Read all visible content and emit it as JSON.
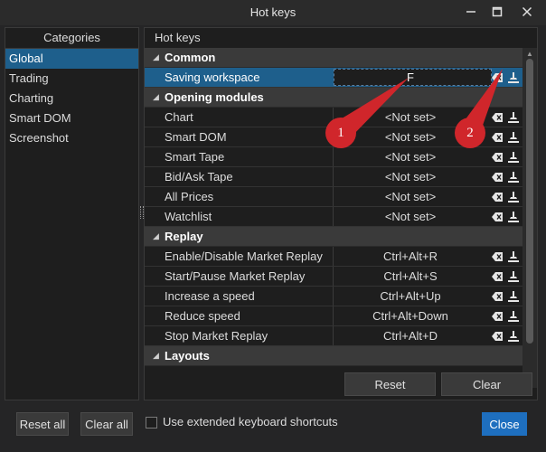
{
  "window": {
    "title": "Hot keys",
    "controls": [
      "minimize-icon",
      "maximize-icon",
      "close-icon"
    ]
  },
  "categories": {
    "header": "Categories",
    "items": [
      "Global",
      "Trading",
      "Charting",
      "Smart DOM",
      "Screenshot"
    ],
    "selected": "Global"
  },
  "hotkeys": {
    "header": "Hot keys",
    "groups": [
      {
        "name": "Common",
        "rows": [
          {
            "name": "Saving workspace",
            "value": "F"
          }
        ]
      },
      {
        "name": "Opening modules",
        "rows": [
          {
            "name": "Chart",
            "value": "<Not set>"
          },
          {
            "name": "Smart DOM",
            "value": "<Not set>"
          },
          {
            "name": "Smart Tape",
            "value": "<Not set>"
          },
          {
            "name": "Bid/Ask Tape",
            "value": "<Not set>"
          },
          {
            "name": "All Prices",
            "value": "<Not set>"
          },
          {
            "name": "Watchlist",
            "value": "<Not set>"
          }
        ]
      },
      {
        "name": "Replay",
        "rows": [
          {
            "name": "Enable/Disable Market Replay",
            "value": "Ctrl+Alt+R"
          },
          {
            "name": "Start/Pause Market Replay",
            "value": "Ctrl+Alt+S"
          },
          {
            "name": "Increase a speed",
            "value": "Ctrl+Alt+Up"
          },
          {
            "name": "Reduce speed",
            "value": "Ctrl+Alt+Down"
          },
          {
            "name": "Stop Market Replay",
            "value": "Ctrl+Alt+D"
          }
        ]
      },
      {
        "name": "Layouts",
        "rows": []
      }
    ],
    "row_icons": [
      "backspace-clear-icon",
      "record-key-icon"
    ]
  },
  "buttons": {
    "reset": "Reset",
    "clear": "Clear",
    "reset_all": "Reset all",
    "clear_all": "Clear all",
    "close": "Close"
  },
  "extended_shortcuts": {
    "label": "Use extended keyboard shortcuts",
    "checked": false
  },
  "callouts": [
    "1",
    "2"
  ],
  "colors": {
    "selection": "#1e5f8c",
    "primary_button": "#1e6fbf",
    "callout": "#d0262b"
  }
}
